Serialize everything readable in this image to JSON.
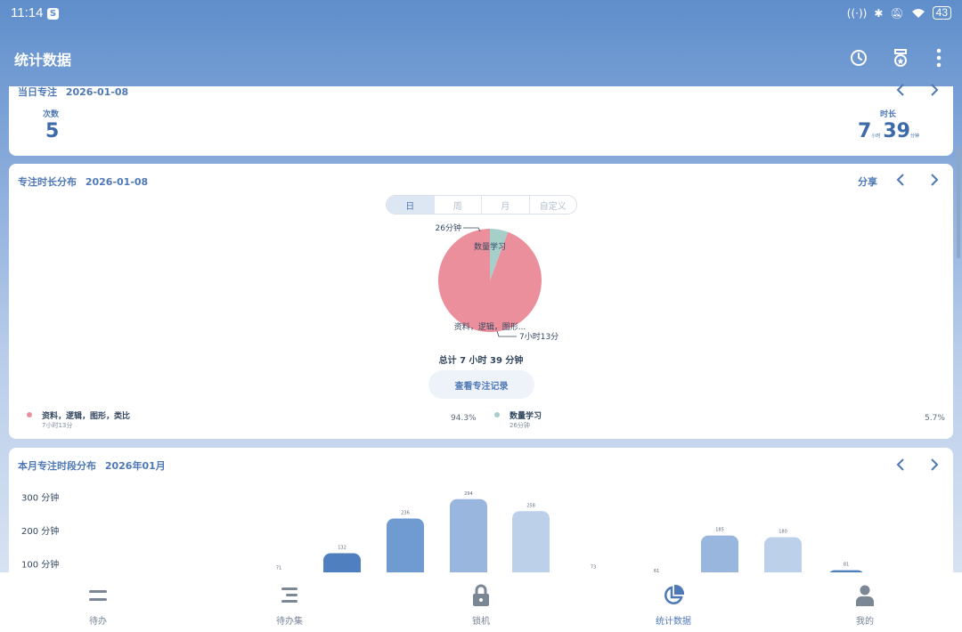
{
  "status_bar": {
    "time": "11:14",
    "badge": "S",
    "battery": "43"
  },
  "app_bar": {
    "title": "统计数据"
  },
  "today_focus": {
    "title": "当日专注",
    "date": "2026-01-08",
    "count_label": "次数",
    "count_value": "5",
    "duration_label": "时长",
    "duration_hours": "7",
    "hours_unit": "小时",
    "duration_minutes": "39",
    "minutes_unit": "分钟"
  },
  "distribution": {
    "title": "专注时长分布",
    "date": "2026-01-08",
    "share_label": "分享",
    "tabs": [
      "日",
      "周",
      "月",
      "自定义"
    ],
    "active_tab": 0,
    "total_text": "总计 7 小时 39 分钟",
    "view_button": "查看专注记录",
    "pie_slice_labels": [
      "资料，逻辑，图形...",
      "数量学习"
    ],
    "pie_callouts": [
      "7小时13分",
      "26分钟"
    ],
    "legend": [
      {
        "name": "资料，逻辑，图形，类比",
        "duration": "7小时13分",
        "percent": "94.3%",
        "color": "#ec8f9c"
      },
      {
        "name": "数量学习",
        "duration": "26分钟",
        "percent": "5.7%",
        "color": "#a6cfc9"
      }
    ]
  },
  "monthly": {
    "title": "本月专注时段分布",
    "date": "2026年01月"
  },
  "chart_data": [
    {
      "type": "pie",
      "labels": [
        "资料，逻辑，图形，类比",
        "数量学习"
      ],
      "values": [
        433,
        26
      ],
      "percentages": [
        94.3,
        5.7
      ],
      "colors": [
        "#ec8f9c",
        "#a6cfc9"
      ],
      "annotations": [
        "7小时13分",
        "26分钟"
      ],
      "title": "专注时长分布"
    },
    {
      "type": "bar",
      "title": "本月专注时段分布",
      "y_ticks": [
        "100 分钟",
        "200 分钟",
        "300 分钟"
      ],
      "ylim": [
        0,
        300
      ],
      "grid": false,
      "data_labels": [
        "71",
        "132",
        "236",
        "294",
        "258",
        "73",
        "61",
        "185",
        "180",
        "81"
      ],
      "values": [
        71,
        132,
        236,
        294,
        258,
        73,
        61,
        185,
        180,
        81
      ],
      "colors": [
        "#a7bfe0",
        "#4f7fbf",
        "#6f9bd0",
        "#98b6de",
        "#bdd0ea",
        "#a7bfe0",
        "#a7bfe0",
        "#98b6de",
        "#bdd0ea",
        "#4f7fbf"
      ]
    }
  ],
  "bottom_nav": [
    {
      "label": "待办",
      "icon": "todo-icon"
    },
    {
      "label": "待办集",
      "icon": "todo-collection-icon"
    },
    {
      "label": "锁机",
      "icon": "lock-icon"
    },
    {
      "label": "统计数据",
      "icon": "pie-chart-icon",
      "active": true
    },
    {
      "label": "我的",
      "icon": "profile-icon"
    }
  ]
}
